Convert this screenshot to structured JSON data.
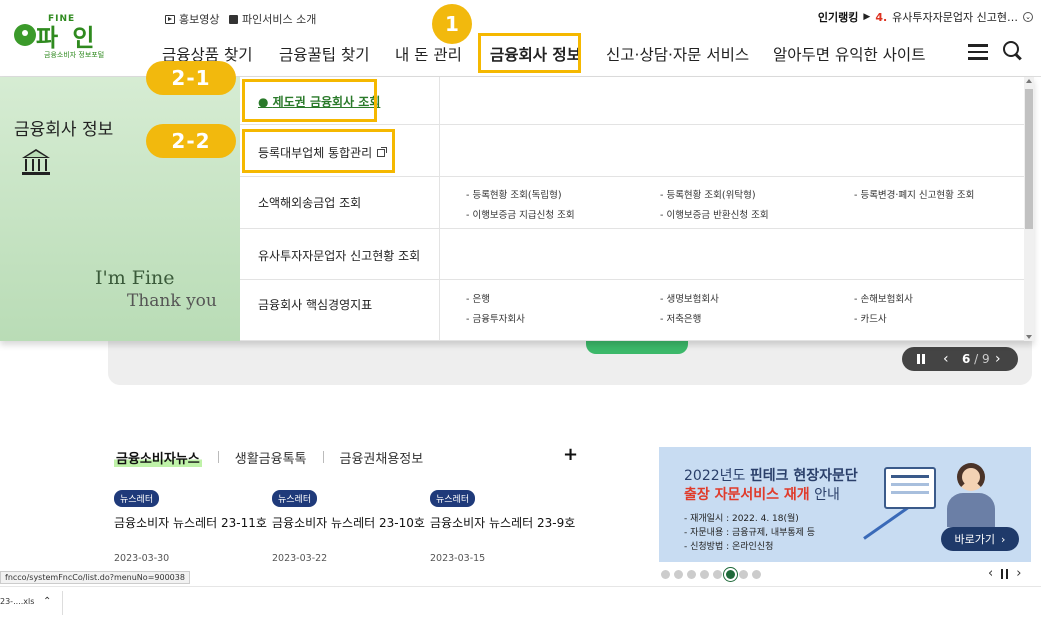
{
  "header": {
    "logo_top": "FINE",
    "logo_text": "파 인",
    "logo_sub": "금융소비자 정보포털",
    "util_links": [
      "홍보영상",
      "파인서비스 소개"
    ],
    "ranking_label": "인기랭킹",
    "ranking_num": "4.",
    "ranking_text": "유사투자자문업자 신고현…"
  },
  "gnb": {
    "items": [
      "금융상품 찾기",
      "금융꿀팁 찾기",
      "내 돈 관리",
      "금융회사 정보",
      "신고·상담·자문 서비스",
      "알아두면 유익한 사이트"
    ],
    "active_index": 3
  },
  "annotations": {
    "step1": "1",
    "step2_1": "2-1",
    "step2_2": "2-2"
  },
  "dropdown": {
    "title": "금융회사 정보",
    "im_fine": "I'm Fine",
    "thank_you": "Thank you",
    "rows": [
      {
        "label": "제도권 금융회사 조회",
        "subs": []
      },
      {
        "label": "등록대부업체 통합관리",
        "subs": []
      },
      {
        "label": "소액해외송금업 조회",
        "subs": [
          "- 등록현황 조회(독립형)",
          "- 등록현황 조회(위탁형)",
          "- 등록변경·폐지 신고현황 조회",
          "- 이행보증금 지급신청 조회",
          "- 이행보증금 반환신청 조회"
        ]
      },
      {
        "label": "유사투자자문업자 신고현황 조회",
        "subs": []
      },
      {
        "label": "금융회사 핵심경영지표",
        "subs": [
          "- 은행",
          "- 생명보험회사",
          "- 손해보험회사",
          "- 금융투자회사",
          "- 저축은행",
          "- 카드사"
        ]
      }
    ]
  },
  "banner": {
    "page_current": "6",
    "page_total": "9"
  },
  "news": {
    "tabs": [
      "금융소비자뉴스",
      "생활금융톡톡",
      "금융권채용정보"
    ],
    "plus": "+",
    "cards": [
      {
        "badge": "뉴스레터",
        "title": "금융소비자 뉴스레터 23-11호",
        "date": "2023-03-30"
      },
      {
        "badge": "뉴스레터",
        "title": "금융소비자 뉴스레터 23-10호",
        "date": "2023-03-22"
      },
      {
        "badge": "뉴스레터",
        "title": "금융소비자 뉴스레터 23-9호",
        "date": "2023-03-15"
      }
    ]
  },
  "ad": {
    "line1_a": "2022년도 ",
    "line1_b": "핀테크 현장자문단",
    "line2_a": "출장 자문서비스 재개",
    "line2_b": " 안내",
    "details": [
      "- 재개일시 : 2022. 4. 18(월)",
      "- 자문내용 : 금융규제, 내부통제 등",
      "- 신청방법 : 온라인신청"
    ],
    "button": "바로가기"
  },
  "status": {
    "url": "fncco/systemFncCo/list.do?menuNo=900038",
    "download_file": "23-....xls"
  }
}
